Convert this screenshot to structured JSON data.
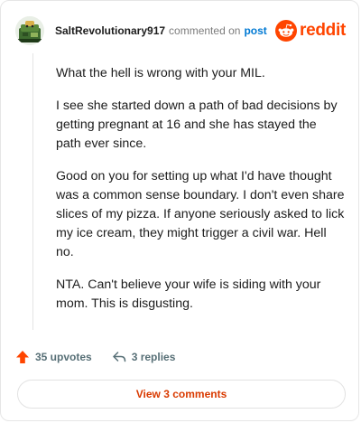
{
  "comment": {
    "username": "SaltRevolutionary917",
    "action_text": "commented on",
    "post_link": "post",
    "paragraphs": [
      "What the hell is wrong with your MIL.",
      "I see she started down a path of bad decisions by getting pregnant at 16 and she has stayed the path ever since.",
      "Good on you for setting up what I'd have thought was a common sense boundary. I don't even share slices of my pizza. If anyone seriously asked to lick my ice cream, they might trigger a civil war. Hell no.",
      "NTA. Can't believe your wife is siding with your mom. This is disgusting."
    ]
  },
  "brand": {
    "name": "reddit",
    "icon": "reddit-logo-icon",
    "color": "#ff4500"
  },
  "actions": {
    "upvotes_label": "35 upvotes",
    "upvote_icon": "upvote-arrow-icon",
    "upvote_color": "#ff4500",
    "replies_label": "3 replies",
    "reply_icon": "reply-arrow-icon"
  },
  "view_comments_label": "View 3 comments",
  "accent_color": "#d93a00",
  "link_color": "#0079d3"
}
